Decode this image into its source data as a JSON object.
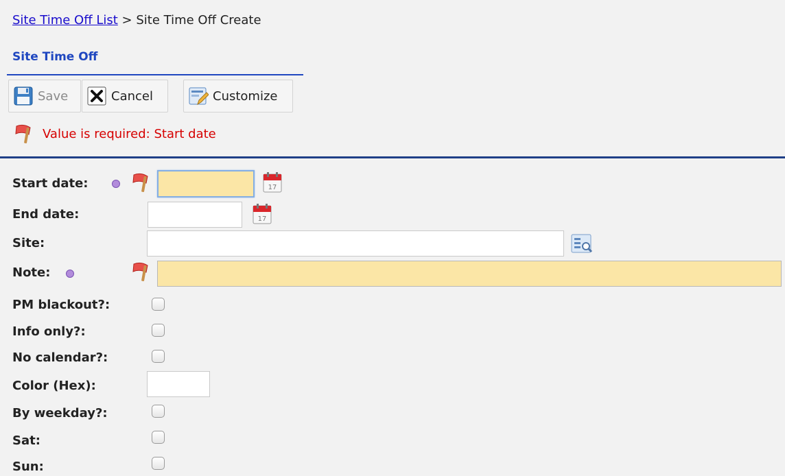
{
  "breadcrumb": {
    "link": "Site Time Off List",
    "separator": ">",
    "current": "Site Time Off Create"
  },
  "title": "Site Time Off",
  "toolbar": {
    "save": "Save",
    "cancel": "Cancel",
    "customize": "Customize"
  },
  "error_message": "Value is required: Start date",
  "form": {
    "start_date": {
      "label": "Start date:",
      "value": ""
    },
    "end_date": {
      "label": "End date:",
      "value": ""
    },
    "site": {
      "label": "Site:",
      "value": ""
    },
    "note": {
      "label": "Note:",
      "value": ""
    },
    "pm_blackout": {
      "label": "PM blackout?:"
    },
    "info_only": {
      "label": "Info only?:"
    },
    "no_calendar": {
      "label": "No calendar?:"
    },
    "color_hex": {
      "label": "Color (Hex):",
      "value": ""
    },
    "by_weekday": {
      "label": "By weekday?:"
    },
    "sat": {
      "label": "Sat:"
    },
    "sun": {
      "label": "Sun:"
    }
  },
  "colors": {
    "required_field": "#fbe6a6",
    "error_text": "#d60000",
    "title": "#1f47c0",
    "link": "#1a0dcc"
  },
  "icons": {
    "save": "floppy-icon",
    "cancel": "close-box-icon",
    "customize": "edit-form-icon",
    "flag": "red-flag-icon",
    "calendar": "calendar-icon",
    "lookup": "lookup-icon",
    "required": "required-dot-icon"
  }
}
